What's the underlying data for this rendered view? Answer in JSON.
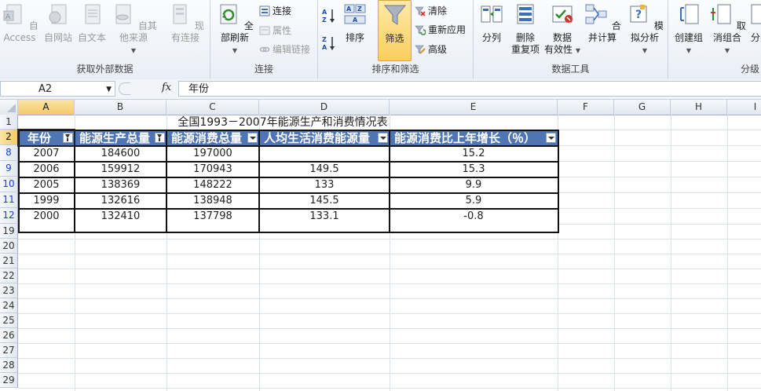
{
  "ribbon": {
    "get_external_data": {
      "label": "获取外部数据",
      "buttons": [
        "自 Access",
        "自网站",
        "自文本",
        "自其他来源",
        "现有连接"
      ]
    },
    "connections": {
      "label": "连接",
      "refresh_all": "全部刷新",
      "connections": "连接",
      "properties": "属性",
      "edit_links": "编辑链接"
    },
    "sort_filter": {
      "label": "排序和筛选",
      "sort": "排序",
      "filter": "筛选",
      "clear": "清除",
      "reapply": "重新应用",
      "advanced": "高级"
    },
    "data_tools": {
      "label": "数据工具",
      "text_to_columns": "分列",
      "remove_duplicates_1": "删除",
      "remove_duplicates_2": "重复项",
      "validation_1": "数据",
      "validation_2": "有效性",
      "consolidate": "合并计算",
      "what_if": "模拟分析"
    },
    "outline": {
      "label": "分级",
      "group": "创建组",
      "ungroup": "取消组合",
      "subtotal": "分类"
    }
  },
  "formula_bar": {
    "name_box": "A2",
    "fx": "fx",
    "formula": "年份"
  },
  "columns": [
    "A",
    "B",
    "C",
    "D",
    "E",
    "F",
    "G",
    "H",
    "I"
  ],
  "rows": [
    "1",
    "2",
    "8",
    "9",
    "10",
    "11",
    "12",
    "19",
    "20",
    "21",
    "22",
    "23",
    "24",
    "25",
    "26",
    "27",
    "28",
    "29"
  ],
  "sheet": {
    "title": "全国1993－2007年能源生产和消费情况表",
    "headers": [
      "年份",
      "能源生产总量",
      "能源消费总量",
      "人均生活消费能源量",
      "能源消费比上年增长（％）"
    ],
    "data": [
      [
        "2007",
        "184600",
        "197000",
        "",
        "15.2"
      ],
      [
        "2006",
        "159912",
        "170943",
        "149.5",
        "15.3"
      ],
      [
        "2005",
        "138369",
        "148222",
        "133",
        "9.9"
      ],
      [
        "1999",
        "132616",
        "138948",
        "145.5",
        "5.9"
      ],
      [
        "2000",
        "132410",
        "137798",
        "133.1",
        "-0.8"
      ]
    ]
  },
  "colors": {
    "header_fill": "#4f75b5",
    "selected_header": "#f3c96b",
    "filtered_row_number": "#1b3fd0"
  }
}
